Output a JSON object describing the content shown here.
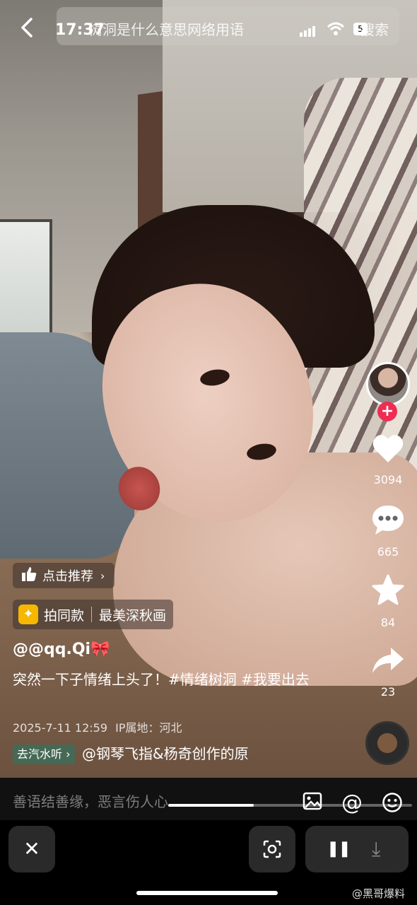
{
  "status_bar": {
    "time": "17:37",
    "battery": "5"
  },
  "search": {
    "query": "树洞是什么意思网络用语",
    "button_label": "搜索"
  },
  "actions": {
    "likes": "3094",
    "comments": "665",
    "favorites": "84",
    "shares": "23",
    "follow_symbol": "+"
  },
  "recommend": {
    "label": "点击推荐",
    "chevron": "›"
  },
  "same_style": {
    "label": "拍同款",
    "effect_name": "最美深秋画"
  },
  "post": {
    "username": "@@qq.Qi🎀",
    "caption": "突然一下子情绪上头了！#情绪树洞 #我要出去",
    "datetime": "2025-7-11 12:59",
    "ip_location": "IP属地：河北"
  },
  "music": {
    "tag": "去汽水听 ›",
    "text": "@钢琴飞指&杨奇创作的原"
  },
  "comment_bar": {
    "placeholder": "善语结善缘，恶言伤人心",
    "progress": 0.35
  },
  "bottom_controls": {
    "close_symbol": "✕",
    "pause_symbol": "❚❚",
    "download_symbol": "⤓"
  },
  "watermark": "@黑哥爆料",
  "colors": {
    "follow_red": "#f02c52",
    "qishui_green": "#3c6e5a",
    "star_gold": "#f5b700"
  }
}
